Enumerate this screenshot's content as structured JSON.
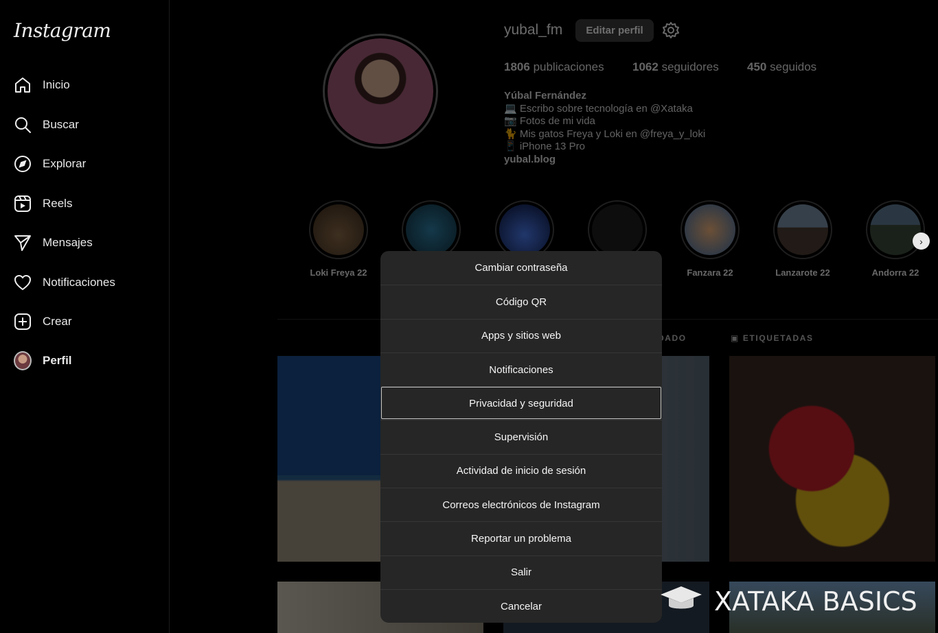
{
  "sidebar": {
    "logo": "Instagram",
    "items": [
      {
        "label": "Inicio",
        "icon": "home-icon"
      },
      {
        "label": "Buscar",
        "icon": "search-icon"
      },
      {
        "label": "Explorar",
        "icon": "compass-icon"
      },
      {
        "label": "Reels",
        "icon": "reels-icon"
      },
      {
        "label": "Mensajes",
        "icon": "send-icon"
      },
      {
        "label": "Notificaciones",
        "icon": "heart-icon"
      },
      {
        "label": "Crear",
        "icon": "plus-square-icon"
      },
      {
        "label": "Perfil",
        "icon": "avatar"
      }
    ]
  },
  "profile": {
    "username": "yubal_fm",
    "edit_label": "Editar perfil",
    "settings_icon": "gear-icon",
    "stats": {
      "posts_count": "1806",
      "posts_label": "publicaciones",
      "followers_count": "1062",
      "followers_label": "seguidores",
      "following_count": "450",
      "following_label": "seguidos"
    },
    "bio": {
      "name": "Yúbal Fernández",
      "lines": [
        "💻 Escribo sobre tecnología en @Xataka",
        "📷 Fotos de mi vida",
        "🐈 Mis gatos Freya y Loki en @freya_y_loki",
        "📱 iPhone 13 Pro"
      ],
      "link": "yubal.blog"
    }
  },
  "highlights": [
    {
      "label": "Loki Freya 22"
    },
    {
      "label": ""
    },
    {
      "label": ""
    },
    {
      "label": ""
    },
    {
      "label": "Fanzara 22"
    },
    {
      "label": "Lanzarote 22"
    },
    {
      "label": "Andorra 22"
    }
  ],
  "tabs": {
    "saved_partial": "DADO",
    "tagged": "ETIQUETADAS"
  },
  "modal": {
    "options": [
      "Cambiar contraseña",
      "Código QR",
      "Apps y sitios web",
      "Notificaciones",
      "Privacidad y seguridad",
      "Supervisión",
      "Actividad de inicio de sesión",
      "Correos electrónicos de Instagram",
      "Reportar un problema",
      "Salir",
      "Cancelar"
    ],
    "focused_index": 4
  },
  "watermark": {
    "text": "XATAKA BASICS"
  },
  "colors": {
    "background": "#000000",
    "modal": "#262626",
    "button": "#3c3c3c",
    "text": "#f5f5f5"
  }
}
